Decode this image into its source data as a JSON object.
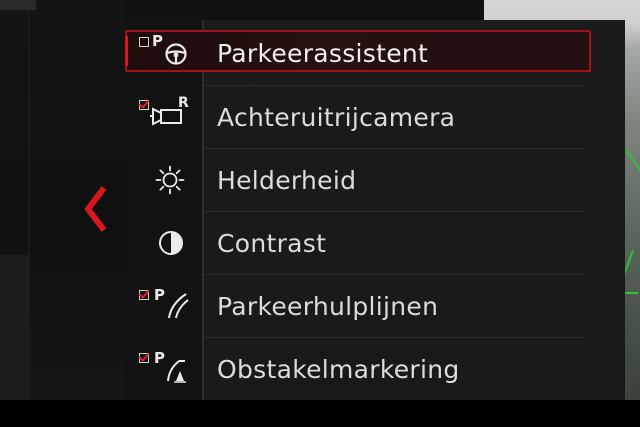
{
  "menu": {
    "items": [
      {
        "label": "Parkeerassistent",
        "icon": "steering-wheel-icon",
        "checkbox": "unchecked",
        "badge": "P",
        "selected": true
      },
      {
        "label": "Achteruitrijcamera",
        "icon": "rear-camera-icon",
        "checkbox": "checked",
        "badge": "R",
        "selected": false
      },
      {
        "label": "Helderheid",
        "icon": "sun-icon",
        "checkbox": null,
        "badge": null,
        "selected": false
      },
      {
        "label": "Contrast",
        "icon": "contrast-icon",
        "checkbox": null,
        "badge": null,
        "selected": false
      },
      {
        "label": "Parkeerhulplijnen",
        "icon": "parking-lines-icon",
        "checkbox": "checked",
        "badge": "P",
        "selected": false
      },
      {
        "label": "Obstakelmarkering",
        "icon": "obstacle-marker-icon",
        "checkbox": "checked",
        "badge": "P",
        "selected": false
      }
    ]
  },
  "nav": {
    "back_icon": "chevron-left-icon"
  },
  "colors": {
    "accent": "#d8161e",
    "text": "#dcdcdc",
    "panel": "#1a1a1a",
    "guide_line": "#2fbf3a"
  }
}
